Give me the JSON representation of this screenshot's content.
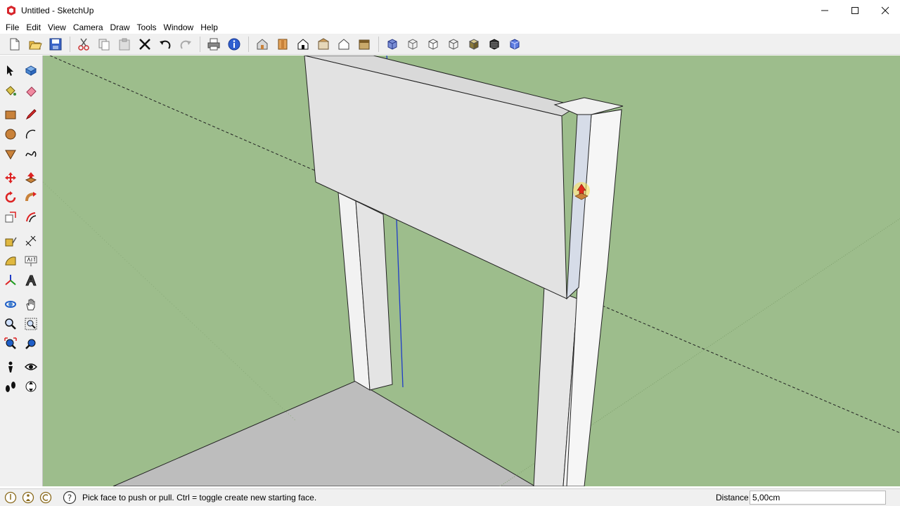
{
  "window": {
    "title": "Untitled - SketchUp"
  },
  "menu": {
    "items": [
      "File",
      "Edit",
      "View",
      "Camera",
      "Draw",
      "Tools",
      "Window",
      "Help"
    ]
  },
  "toolbar": {
    "icons": [
      "new-file-icon",
      "open-file-icon",
      "save-icon",
      "cut-icon",
      "copy-icon",
      "paste-icon",
      "erase-icon",
      "undo-icon",
      "redo-icon",
      "print-icon",
      "model-info-icon",
      "iso-view-icon",
      "top-view-icon",
      "front-view-icon",
      "right-view-icon",
      "back-view-icon",
      "left-view-icon",
      "xray-icon",
      "wireframe-icon",
      "hidden-line-icon",
      "shaded-icon",
      "shaded-textures-icon",
      "monochrome-icon"
    ]
  },
  "left_tools": {
    "icons": [
      "select-arrow-icon",
      "make-component-icon",
      "paint-bucket-icon",
      "eraser-icon",
      "rectangle-icon",
      "pencil-icon",
      "circle-icon",
      "arc-icon",
      "polygon-icon",
      "freehand-icon",
      "move-icon",
      "push-pull-icon",
      "rotate-icon",
      "follow-me-icon",
      "scale-icon",
      "offset-icon",
      "tape-measure-icon",
      "dimension-icon",
      "protractor-icon",
      "text-icon",
      "axes-icon",
      "3d-text-icon",
      "orbit-icon",
      "pan-icon",
      "zoom-icon",
      "zoom-window-icon",
      "zoom-extents-icon",
      "previous-view-icon",
      "position-camera-icon",
      "look-around-icon",
      "walk-icon",
      "section-plane-icon"
    ]
  },
  "status": {
    "message": "Pick face to push or pull.  Ctrl = toggle create new starting face.",
    "measure_label": "Distance",
    "measure_value": "5,00cm"
  },
  "colors": {
    "sky_ground": "#9dbd8c",
    "floor": "#bdbdbd",
    "face_light": "#e2e2e2",
    "face_side": "#f2f2f2",
    "axis_blue": "#1f3cc8",
    "cursor_red": "#e02a1b"
  }
}
